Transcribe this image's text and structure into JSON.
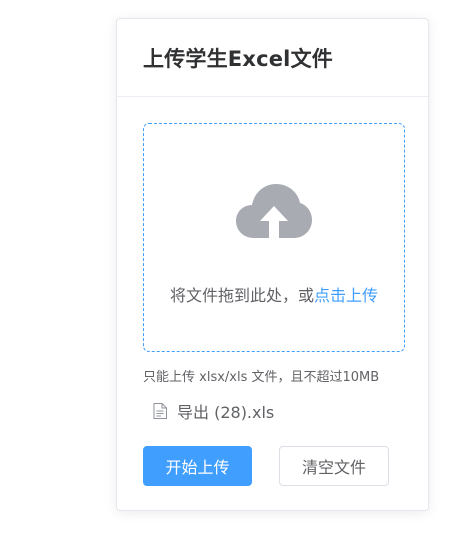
{
  "card": {
    "title": "上传学生Excel文件"
  },
  "upload": {
    "icon": "cloud-upload-icon",
    "drop_text": "将文件拖到此处，或",
    "link_text": "点击上传",
    "tip": "只能上传 xlsx/xls 文件，且不超过10MB",
    "accent_color": "#409eff"
  },
  "file_list": [
    {
      "icon": "document-icon",
      "name": "导出 (28).xls"
    }
  ],
  "actions": {
    "start_upload_label": "开始上传",
    "clear_files_label": "清空文件"
  }
}
